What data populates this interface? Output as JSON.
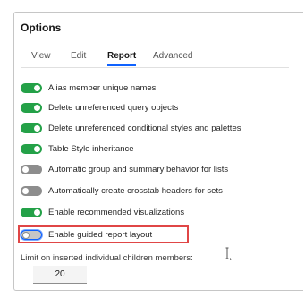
{
  "dialog": {
    "title": "Options"
  },
  "tabs": [
    {
      "label": "View",
      "active": false
    },
    {
      "label": "Edit",
      "active": false
    },
    {
      "label": "Report",
      "active": true
    },
    {
      "label": "Advanced",
      "active": false
    }
  ],
  "toggles": [
    {
      "label": "Alias member unique names",
      "on": true
    },
    {
      "label": "Delete unreferenced query objects",
      "on": true
    },
    {
      "label": "Delete unreferenced conditional styles and palettes",
      "on": true
    },
    {
      "label": "Table Style inheritance",
      "on": true
    },
    {
      "label": "Automatic group and summary behavior for lists",
      "on": false
    },
    {
      "label": "Automatically create crosstab headers for sets",
      "on": false
    },
    {
      "label": "Enable recommended visualizations",
      "on": true
    },
    {
      "label": "Enable guided report layout",
      "on": false,
      "focused": true
    }
  ],
  "limit": {
    "label": "Limit on inserted individual children members:",
    "value": "20"
  },
  "colors": {
    "toggle_on": "#24a148",
    "toggle_off": "#8d8d8d",
    "tab_active_underline": "#0f62fe",
    "highlight_border": "#e04646"
  },
  "icons": {
    "cursor": "text-cursor-icon"
  }
}
